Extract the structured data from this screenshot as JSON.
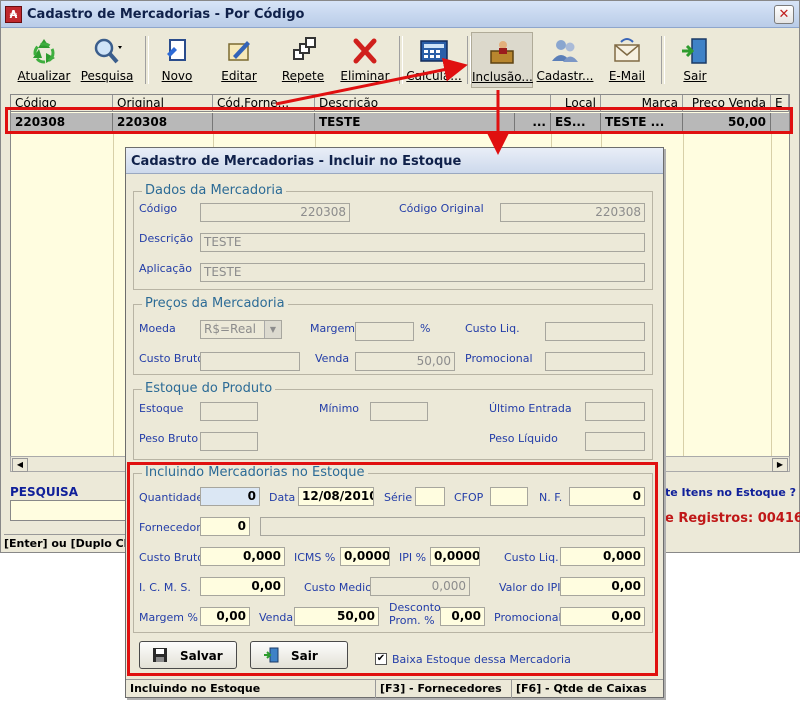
{
  "window": {
    "title": "Cadastro de Mercadorias - Por Código"
  },
  "toolbar": {
    "atualizar": "Atualizar",
    "pesquisa": "Pesquisa",
    "novo": "Novo",
    "editar": "Editar",
    "repete": "Repete",
    "eliminar": "Eliminar",
    "calcula": "Calcula...",
    "inclusao": "Inclusão...",
    "cadastr": "Cadastr...",
    "email": "E-Mail",
    "sair": "Sair"
  },
  "grid": {
    "columns": [
      "Código",
      "Original",
      "Cód.Forne...",
      "Descrição",
      "",
      "Local",
      "Marca",
      "Preço Venda",
      "E"
    ],
    "rows": [
      {
        "codigo": "220308",
        "original": "220308",
        "cod_forn": "",
        "descricao": "TESTE",
        "ellipsis": "...",
        "local": "ES...",
        "marca": "TESTE ...",
        "preco": "50,00"
      }
    ]
  },
  "main_bottom": {
    "pesquisa_label": "PESQUISA",
    "status_left": "[Enter] ou [Duplo Clique]",
    "itens_estoque": "te Itens no Estoque ?",
    "registros": "e Registros: 00416"
  },
  "dialog": {
    "title": "Cadastro de Mercadorias - Incluir no Estoque",
    "dados": {
      "title": "Dados da Mercadoria",
      "codigo_label": "Código",
      "codigo_value": "220308",
      "codigo_original_label": "Código Original",
      "codigo_original_value": "220308",
      "descricao_label": "Descrição",
      "descricao_value": "TESTE",
      "aplicacao_label": "Aplicação",
      "aplicacao_value": "TESTE"
    },
    "precos": {
      "title": "Preços da Mercadoria",
      "moeda_label": "Moeda",
      "moeda_value": "R$=Real",
      "margem_label": "Margem",
      "margem_value": "",
      "pct": "%",
      "custo_liq_label": "Custo Liq.",
      "custo_liq_value": "",
      "custo_bruto_label": "Custo Bruto",
      "custo_bruto_value": "",
      "venda_label": "Venda",
      "venda_value": "50,00",
      "promocional_label": "Promocional",
      "promocional_value": ""
    },
    "estoque": {
      "title": "Estoque do Produto",
      "estoque_label": "Estoque",
      "minimo_label": "Mínimo",
      "ultimo_entrada_label": "Último Entrada",
      "peso_bruto_label": "Peso Bruto",
      "peso_liquido_label": "Peso Líquido"
    },
    "incluindo": {
      "title": "Incluindo Mercadorias no Estoque",
      "quantidade_label": "Quantidade",
      "quantidade_value": "0",
      "data_label": "Data",
      "data_value": "12/08/2010",
      "serie_label": "Série",
      "serie_value": "",
      "cfop_label": "CFOP",
      "cfop_value": "",
      "nf_label": "N. F.",
      "nf_value": "0",
      "fornecedor_label": "Fornecedor",
      "fornecedor_value": "0",
      "fornecedor_nome": "",
      "custo_bruto_label": "Custo Bruto",
      "custo_bruto_value": "0,000",
      "icms_pct_label": "ICMS %",
      "icms_pct_value": "0,0000",
      "ipi_pct_label": "IPI %",
      "ipi_pct_value": "0,0000",
      "custo_liq_label": "Custo Liq.",
      "custo_liq_value": "0,000",
      "icms_label": "I. C. M. S.",
      "icms_value": "0,00",
      "custo_medio_label": "Custo Medio",
      "custo_medio_value": "0,000",
      "valor_ipi_label": "Valor do IPI",
      "valor_ipi_value": "0,00",
      "margem_label": "Margem %",
      "margem_value": "0,00",
      "venda_label": "Venda",
      "venda_value": "50,00",
      "desconto_label_1": "Desconto",
      "desconto_label_2": "Prom. %",
      "desconto_value": "0,00",
      "promocional_label": "Promocional",
      "promocional_value": "0,00"
    },
    "salvar": "Salvar",
    "sair": "Sair",
    "baixa_label": "Baixa Estoque dessa Mercadoria",
    "baixa_checked": true,
    "status": [
      "Incluindo no Estoque",
      "[F3] - Fornecedores",
      "[F6] - Qtde de Caixas"
    ]
  },
  "colors": {
    "highlight": "#e01010",
    "accent": "#233da8",
    "group_title": "#2c6b96"
  }
}
